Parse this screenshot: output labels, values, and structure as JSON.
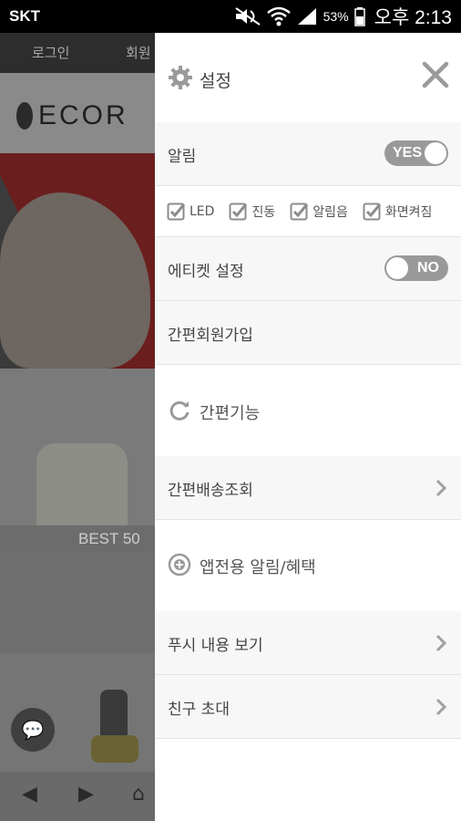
{
  "status_bar": {
    "carrier": "SKT",
    "battery_pct": "53%",
    "time": "오후 2:13",
    "icons": [
      "mute-icon",
      "wifi-icon",
      "signal-icon",
      "battery-icon"
    ]
  },
  "background_app": {
    "top_tabs": [
      "로그인",
      "회원"
    ],
    "logo_text": "ECOR",
    "best_label": "BEST 50",
    "nav_icons": [
      "back-arrow-icon",
      "forward-arrow-icon",
      "home-icon"
    ]
  },
  "drawer": {
    "title": "설정",
    "title_icon": "gear-icon",
    "close_icon": "close-icon",
    "notification": {
      "label": "알림",
      "toggle_text": "YES",
      "enabled": true
    },
    "checkboxes": [
      {
        "label": "LED",
        "checked": true
      },
      {
        "label": "진동",
        "checked": true
      },
      {
        "label": "알림음",
        "checked": true
      },
      {
        "label": "화면켜짐",
        "checked": true
      }
    ],
    "etiquette": {
      "label": "에티켓 설정",
      "toggle_text": "NO",
      "enabled": false
    },
    "simple_signup": "간편회원가입",
    "section_simple": {
      "label": "간편기능",
      "icon": "refresh-icon"
    },
    "delivery_lookup": "간편배송조회",
    "section_app": {
      "label": "앱전용 알림/혜택",
      "icon": "plus-circle-icon"
    },
    "push_view": "푸시 내용 보기",
    "invite_friend": "친구 초대",
    "colors": {
      "toggle_bg": "#999999",
      "check_color": "#8c8c8c",
      "row_bg": "#f7f7f7",
      "divider": "#e3e3e3"
    }
  }
}
